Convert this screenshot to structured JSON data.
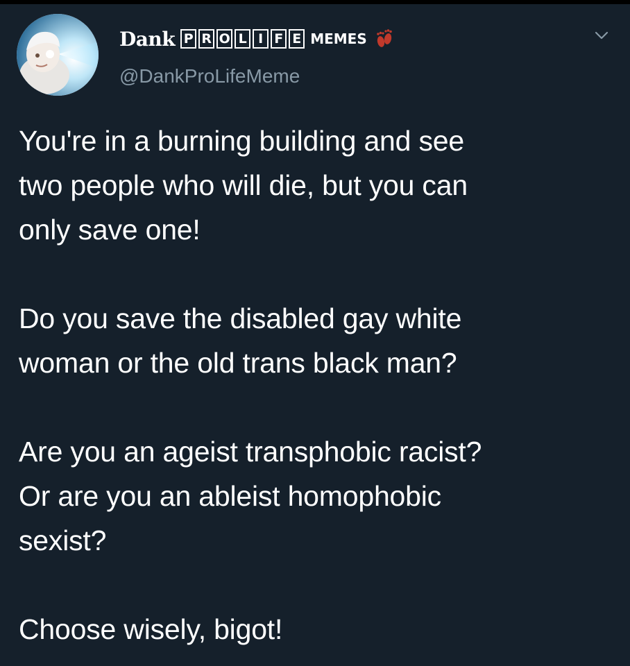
{
  "author": {
    "name_prefix": "Dank",
    "name_boxes": [
      "P",
      "R",
      "O",
      "L",
      "I",
      "F",
      "E"
    ],
    "name_suffix": "MEMES",
    "handle": "@DankProLifeMeme",
    "badge_icon": "baby-feet-icon",
    "avatar_icon": "baby-avatar-icon"
  },
  "menu": {
    "icon": "chevron-down-icon"
  },
  "tweet": {
    "paragraphs": [
      "You're in a burning building and see\ntwo people who will die, but you can\nonly save one!",
      "Do you save the disabled gay white\nwoman or the old trans black man?",
      "Are you an ageist transphobic racist?\nOr are you an ableist homophobic\nsexist?",
      "Choose wisely, bigot!"
    ]
  },
  "colors": {
    "background": "#15202b",
    "text": "#ffffff",
    "handle": "#8899a6",
    "feet": "#c0392b"
  }
}
